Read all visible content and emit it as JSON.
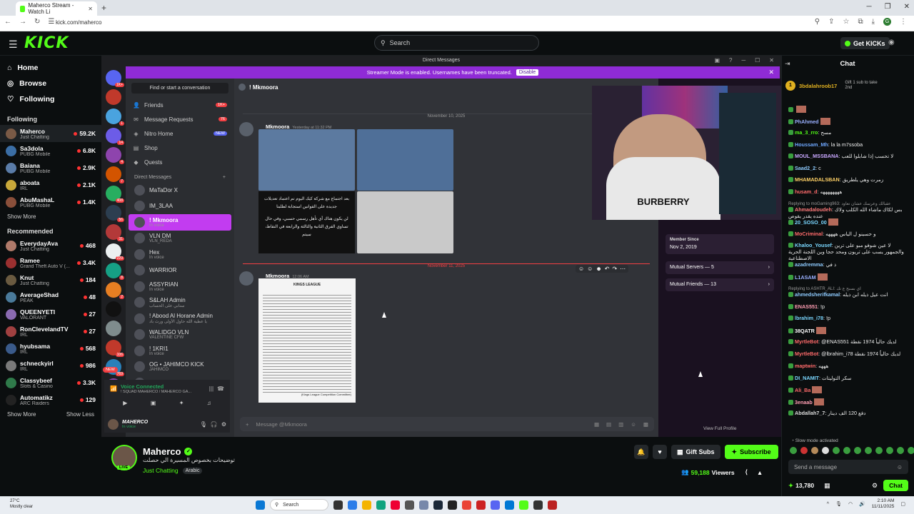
{
  "browser": {
    "tab_title": "Maherco Stream - Watch Li",
    "url": "kick.com/maherco",
    "profile_initial": "G"
  },
  "kick": {
    "logo": "KICK",
    "logo_beta": "BETA",
    "search_placeholder": "Search",
    "get_kicks": "Get KICKs",
    "nav": [
      {
        "label": "Home",
        "icon": "home-icon"
      },
      {
        "label": "Browse",
        "icon": "compass-icon"
      },
      {
        "label": "Following",
        "icon": "heart-icon"
      }
    ],
    "following_title": "Following",
    "following": [
      {
        "name": "Maherco",
        "category": "Just Chatting",
        "viewers": "59.2K",
        "color": "#7a5a46"
      },
      {
        "name": "Sa3dola",
        "category": "PUBG Mobile",
        "viewers": "6.8K",
        "color": "#3b6ea5"
      },
      {
        "name": "Baiana",
        "category": "PUBG Mobile",
        "viewers": "2.9K",
        "color": "#5a7ca8"
      },
      {
        "name": "aboata",
        "category": "IRL",
        "viewers": "2.1K",
        "color": "#c8a83a"
      },
      {
        "name": "AbuMashaL",
        "category": "PUBG Mobile",
        "viewers": "1.4K",
        "color": "#8a4f3a"
      }
    ],
    "show_more": "Show More",
    "show_less": "Show Less",
    "recommended_title": "Recommended",
    "recommended": [
      {
        "name": "EverydayAva",
        "category": "Just Chatting",
        "viewers": "468",
        "color": "#b07a6a"
      },
      {
        "name": "Ramee",
        "category": "Grand Theft Auto V (...",
        "viewers": "3.4K",
        "color": "#9b3030"
      },
      {
        "name": "Knut",
        "category": "Just Chatting",
        "viewers": "184",
        "color": "#6a5a40"
      },
      {
        "name": "AverageShad",
        "category": "PEAK",
        "viewers": "48",
        "color": "#4a7a9a"
      },
      {
        "name": "QUEENYETI",
        "category": "VALORANT",
        "viewers": "27",
        "color": "#8a6ab0"
      },
      {
        "name": "RonClevelandTV",
        "category": "IRL",
        "viewers": "27",
        "color": "#a04040"
      },
      {
        "name": "hyubsama",
        "category": "IRL",
        "viewers": "568",
        "color": "#3a5a8a"
      },
      {
        "name": "schneckyirl",
        "category": "IRL",
        "viewers": "986",
        "color": "#7a7a7a"
      },
      {
        "name": "Classybeef",
        "category": "Slots & Casino",
        "viewers": "3.3K",
        "color": "#2f7a4a"
      },
      {
        "name": "Automatikz",
        "category": "ARC Raiders",
        "viewers": "129",
        "color": "#222222"
      }
    ]
  },
  "discord": {
    "window_title": "Direct Messages",
    "banner_text": "Streamer Mode is enabled. Usernames have been truncated.",
    "banner_button": "Disable",
    "find_conversation": "Find or start a conversation",
    "nav": [
      {
        "label": "Friends",
        "icon": "friends-icon",
        "badge": "1K+"
      },
      {
        "label": "Message Requests",
        "icon": "mail-icon",
        "badge": "76"
      },
      {
        "label": "Nitro Home",
        "icon": "nitro-icon",
        "new": "NEW"
      },
      {
        "label": "Shop",
        "icon": "shop-icon"
      },
      {
        "label": "Quests",
        "icon": "quests-icon"
      }
    ],
    "dm_header": "Direct Messages",
    "dms": [
      {
        "name": "MaTaDor X",
        "sub": ""
      },
      {
        "name": "IM_3LAA",
        "sub": ""
      },
      {
        "name": "! Mkmoora",
        "sub": "In voice",
        "selected": true
      },
      {
        "name": "VLN DM",
        "sub": "VLN_REDA"
      },
      {
        "name": "Hex",
        "sub": "In voice"
      },
      {
        "name": "WARRIOR",
        "sub": ""
      },
      {
        "name": "ASSYRIAN",
        "sub": "In voice"
      },
      {
        "name": "S&LAH  Admin",
        "sub": "سنابي على الحساب"
      },
      {
        "name": "! Abood Al Horane  Admin",
        "sub": "يا عطية الله حاول الأولى ورث باد"
      },
      {
        "name": "WALIDGO  VLN",
        "sub": "VALENTINE CFW"
      },
      {
        "name": "! 1KRI1",
        "sub": "In voice"
      },
      {
        "name": "OG • JAHIMCO  KICK",
        "sub": "JAHIMCO"
      },
      {
        "name": "",
        "sub": "In voice"
      }
    ],
    "voice_status": "Voice Connected",
    "voice_channel": "! SQUAD MAHERCO / MAHERCO GA...",
    "user_name": "MAHERCO",
    "user_status": "In voice",
    "chat_name": "! Mkmoora",
    "date1": "November 10, 2025",
    "msg1_author": "Mkmoora",
    "msg1_time": "Yesterday at 11:32 PM",
    "msg1_caption1": "بعد اجتماع مع شركة كيك اليوم تم اعتماد تعديلات جديدة على القوانين استجابة لطلبنا",
    "msg1_caption2": "لن يكون هناك أي تأهل رسمي حسبي، وفي حال تساوي الفرق الثانية والثالثة والرابعة في النقاط، سيتم",
    "date2": "November 11, 2025",
    "msg2_author": "Mkmoora",
    "msg2_time": "12:06 AM",
    "doc_heading": "KINGS LEAGUE",
    "doc_footer": "(Kings League Competition Committee)",
    "input_placeholder": "Message @Mkmoora",
    "member_since_label": "Member Since",
    "member_since": "Nov 2, 2019",
    "mutual_servers": "Mutual Servers — 5",
    "mutual_friends": "Mutual Friends — 13",
    "view_profile": "View Full Profile",
    "new_badge": "NEW",
    "servers": [
      {
        "color": "#5865f2",
        "badge": "1K+"
      },
      {
        "color": "#c0392b",
        "badge": ""
      },
      {
        "color": "#4aa3df",
        "badge": "1"
      },
      {
        "color": "#6c5ce7",
        "badge": "14"
      },
      {
        "color": "#8e44ad",
        "badge": "4"
      },
      {
        "color": "#d35400",
        "badge": "7"
      },
      {
        "color": "#27ae60",
        "badge": "408"
      },
      {
        "color": "#2c3e50",
        "badge": "56"
      },
      {
        "color": "#b33939",
        "badge": "31"
      },
      {
        "color": "#ecf0f1",
        "badge": "229"
      },
      {
        "color": "#16a085",
        "badge": "8"
      },
      {
        "color": "#e67e22",
        "badge": "2"
      },
      {
        "color": "#111111",
        "badge": ""
      },
      {
        "color": "#7f8c8d",
        "badge": ""
      },
      {
        "color": "#c0392b",
        "badge": "106"
      },
      {
        "color": "#2980b9",
        "badge": "769"
      },
      {
        "color": "#8e44ad",
        "badge": "375"
      }
    ]
  },
  "stream": {
    "name": "Maherco",
    "title": "توضيحات بخصوص المسيرة الي حصلت",
    "category": "Just Chatting",
    "language": "Arabic",
    "live": "LIVE",
    "gift_subs": "Gift Subs",
    "subscribe": "Subscribe",
    "viewers": "59,188",
    "viewers_label": "Viewers",
    "webcam_shirt": "BURBERRY"
  },
  "chat": {
    "title": "Chat",
    "gifter": "3bdalahroob17",
    "gift_text": "Gift 1 sub to take 2nd",
    "gift_count": "1",
    "messages": [
      {
        "user": "",
        "text": "",
        "color": "#53fc18",
        "emote": true
      },
      {
        "user": "PhAhmed",
        "text": "",
        "color": "#9ab0ff",
        "emote": true
      },
      {
        "user": "ma_3_rro",
        "text": "مسح",
        "color": "#53fc18"
      },
      {
        "user": "Houssam_Mh",
        "text": "la la m7ssoba",
        "color": "#6fa8ff"
      },
      {
        "user": "MOUL_MSSBANA",
        "text": "لا تحسب إذا شابلوا للعب",
        "color": "#c9a8ff"
      },
      {
        "user": "Saad2_2",
        "text": "c",
        "color": "#8ecbff"
      },
      {
        "user": "MHAMADALSBAN",
        "text": "زمرت وهي يلطريق",
        "color": "#ffd166"
      },
      {
        "user": "husam_d",
        "text": "ههههههههه",
        "color": "#ff6b6b"
      },
      {
        "reply": "Replying to moGaming963: عقبالك وعرسك عشان تعاود"
      },
      {
        "user": "Ahmadaloudeh",
        "text": "بس لكاك ماشاء الله الكلب ولاك عنده يقدر يقوص",
        "color": "#ff7a7a"
      },
      {
        "user": "20_SOSO_00",
        "text": "",
        "color": "#7ad7ff",
        "emote": true
      },
      {
        "user": "MoCriminal",
        "text": "و حسينو ل الياس ههههه",
        "color": "#ff6b6b"
      },
      {
        "user": "Khaloo_Yousef",
        "text": "لا عين شوفو مبو على ترين والجمهور يسب على تريون ومحد حجا وين اللجنة الحرية الاصطناعية",
        "color": "#7ad7ff"
      },
      {
        "user": "azadremma",
        "text": "ذ في",
        "color": "#8ecbff"
      },
      {
        "user": "L1ASAM",
        "text": "",
        "color": "#9ab0ff",
        "emote": true
      },
      {
        "reply": "Replying to ASHTR_ALI: اي بسبح ع تك"
      },
      {
        "user": "ahmedsherifkamal",
        "text": "انت عيل ذيله ابن ذيله",
        "color": "#8ecbff"
      },
      {
        "user": "ENAS551",
        "text": "!p",
        "color": "#ff9eb3"
      },
      {
        "user": "lbrahim_i78",
        "text": "!p",
        "color": "#7ad7ff"
      },
      {
        "user": "38QATR",
        "text": "",
        "color": "#fff",
        "emote": true
      },
      {
        "user": "MyrtleBot",
        "text": "@ENAS551 لديك حالياً 1974 نقطة",
        "color": "#ff6b6b"
      },
      {
        "user": "MyrtleBot",
        "text": "@lbrahim_i78 لديك حالياً 1974 نقطة",
        "color": "#ff6b6b"
      },
      {
        "user": "maptwin",
        "text": "هههه",
        "color": "#ff6b6b"
      },
      {
        "user": "DI_NAMIT",
        "text": "سكر التوليتات",
        "color": "#7ad7ff"
      },
      {
        "user": "Ali_Ba",
        "text": "",
        "color": "#ff6b6b",
        "emote": true
      },
      {
        "user": "3enaab",
        "text": "",
        "color": "#ff9eb3",
        "emote": true
      },
      {
        "user": "Abdallah7_7",
        "text": "دفع 120 الف دينار",
        "color": "#ddd"
      }
    ],
    "slow_mode": "Slow mode activated",
    "send_placeholder": "Send a message",
    "kicks_amount": "13,780",
    "chat_button": "Chat"
  },
  "taskbar": {
    "temp": "27°C",
    "weather": "Mostly clear",
    "search": "Search",
    "time": "2:10 AM",
    "date": "11/11/2025"
  }
}
